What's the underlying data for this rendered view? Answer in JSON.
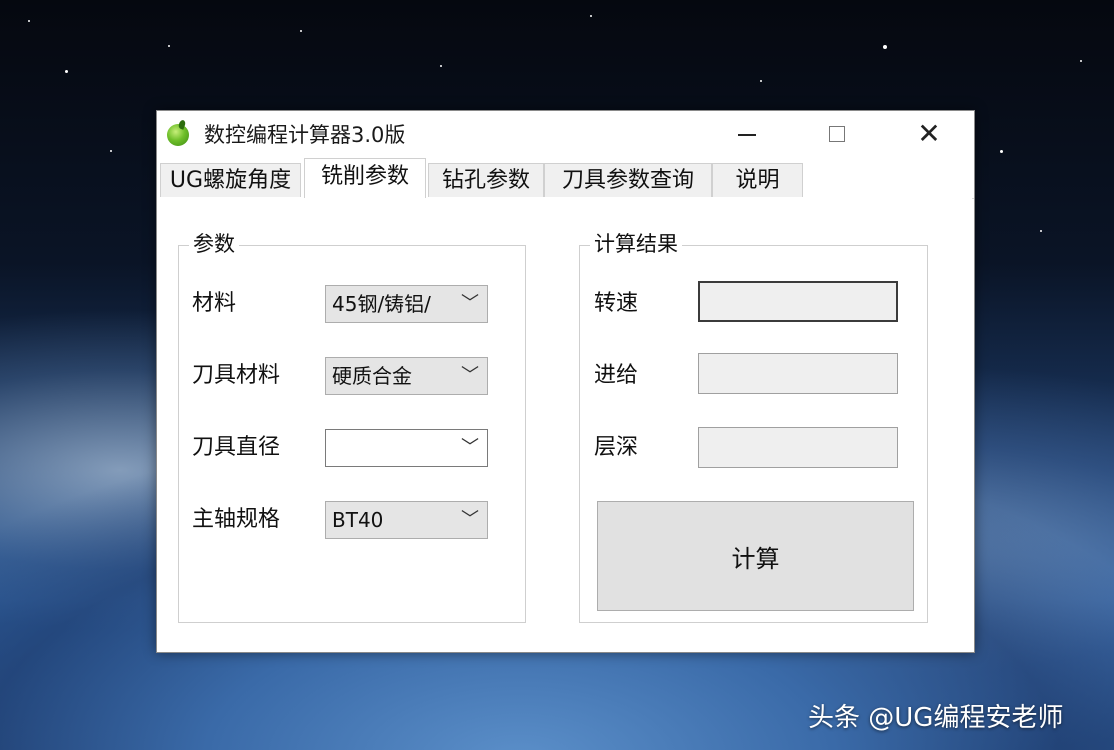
{
  "window": {
    "title": "数控编程计算器3.0版",
    "icon": "green-apple-icon"
  },
  "tabs": [
    {
      "label": "UG螺旋角度",
      "active": false
    },
    {
      "label": "铣削参数",
      "active": true
    },
    {
      "label": "钻孔参数",
      "active": false
    },
    {
      "label": "刀具参数查询",
      "active": false
    },
    {
      "label": "说明",
      "active": false
    }
  ],
  "params_group": {
    "legend": "参数",
    "fields": [
      {
        "label": "材料",
        "value": "45钢/铸铝/"
      },
      {
        "label": "刀具材料",
        "value": "硬质合金"
      },
      {
        "label": "刀具直径",
        "value": ""
      },
      {
        "label": "主轴规格",
        "value": "BT40"
      }
    ]
  },
  "results_group": {
    "legend": "计算结果",
    "fields": [
      {
        "label": "转速",
        "value": ""
      },
      {
        "label": "进给",
        "value": ""
      },
      {
        "label": "层深",
        "value": ""
      }
    ],
    "calc_button": "计算"
  },
  "watermark": "头条 @UG编程安老师",
  "colors": {
    "window_bg": "#ffffff",
    "button_bg": "#e1e1e1",
    "output_bg": "#efefef"
  }
}
